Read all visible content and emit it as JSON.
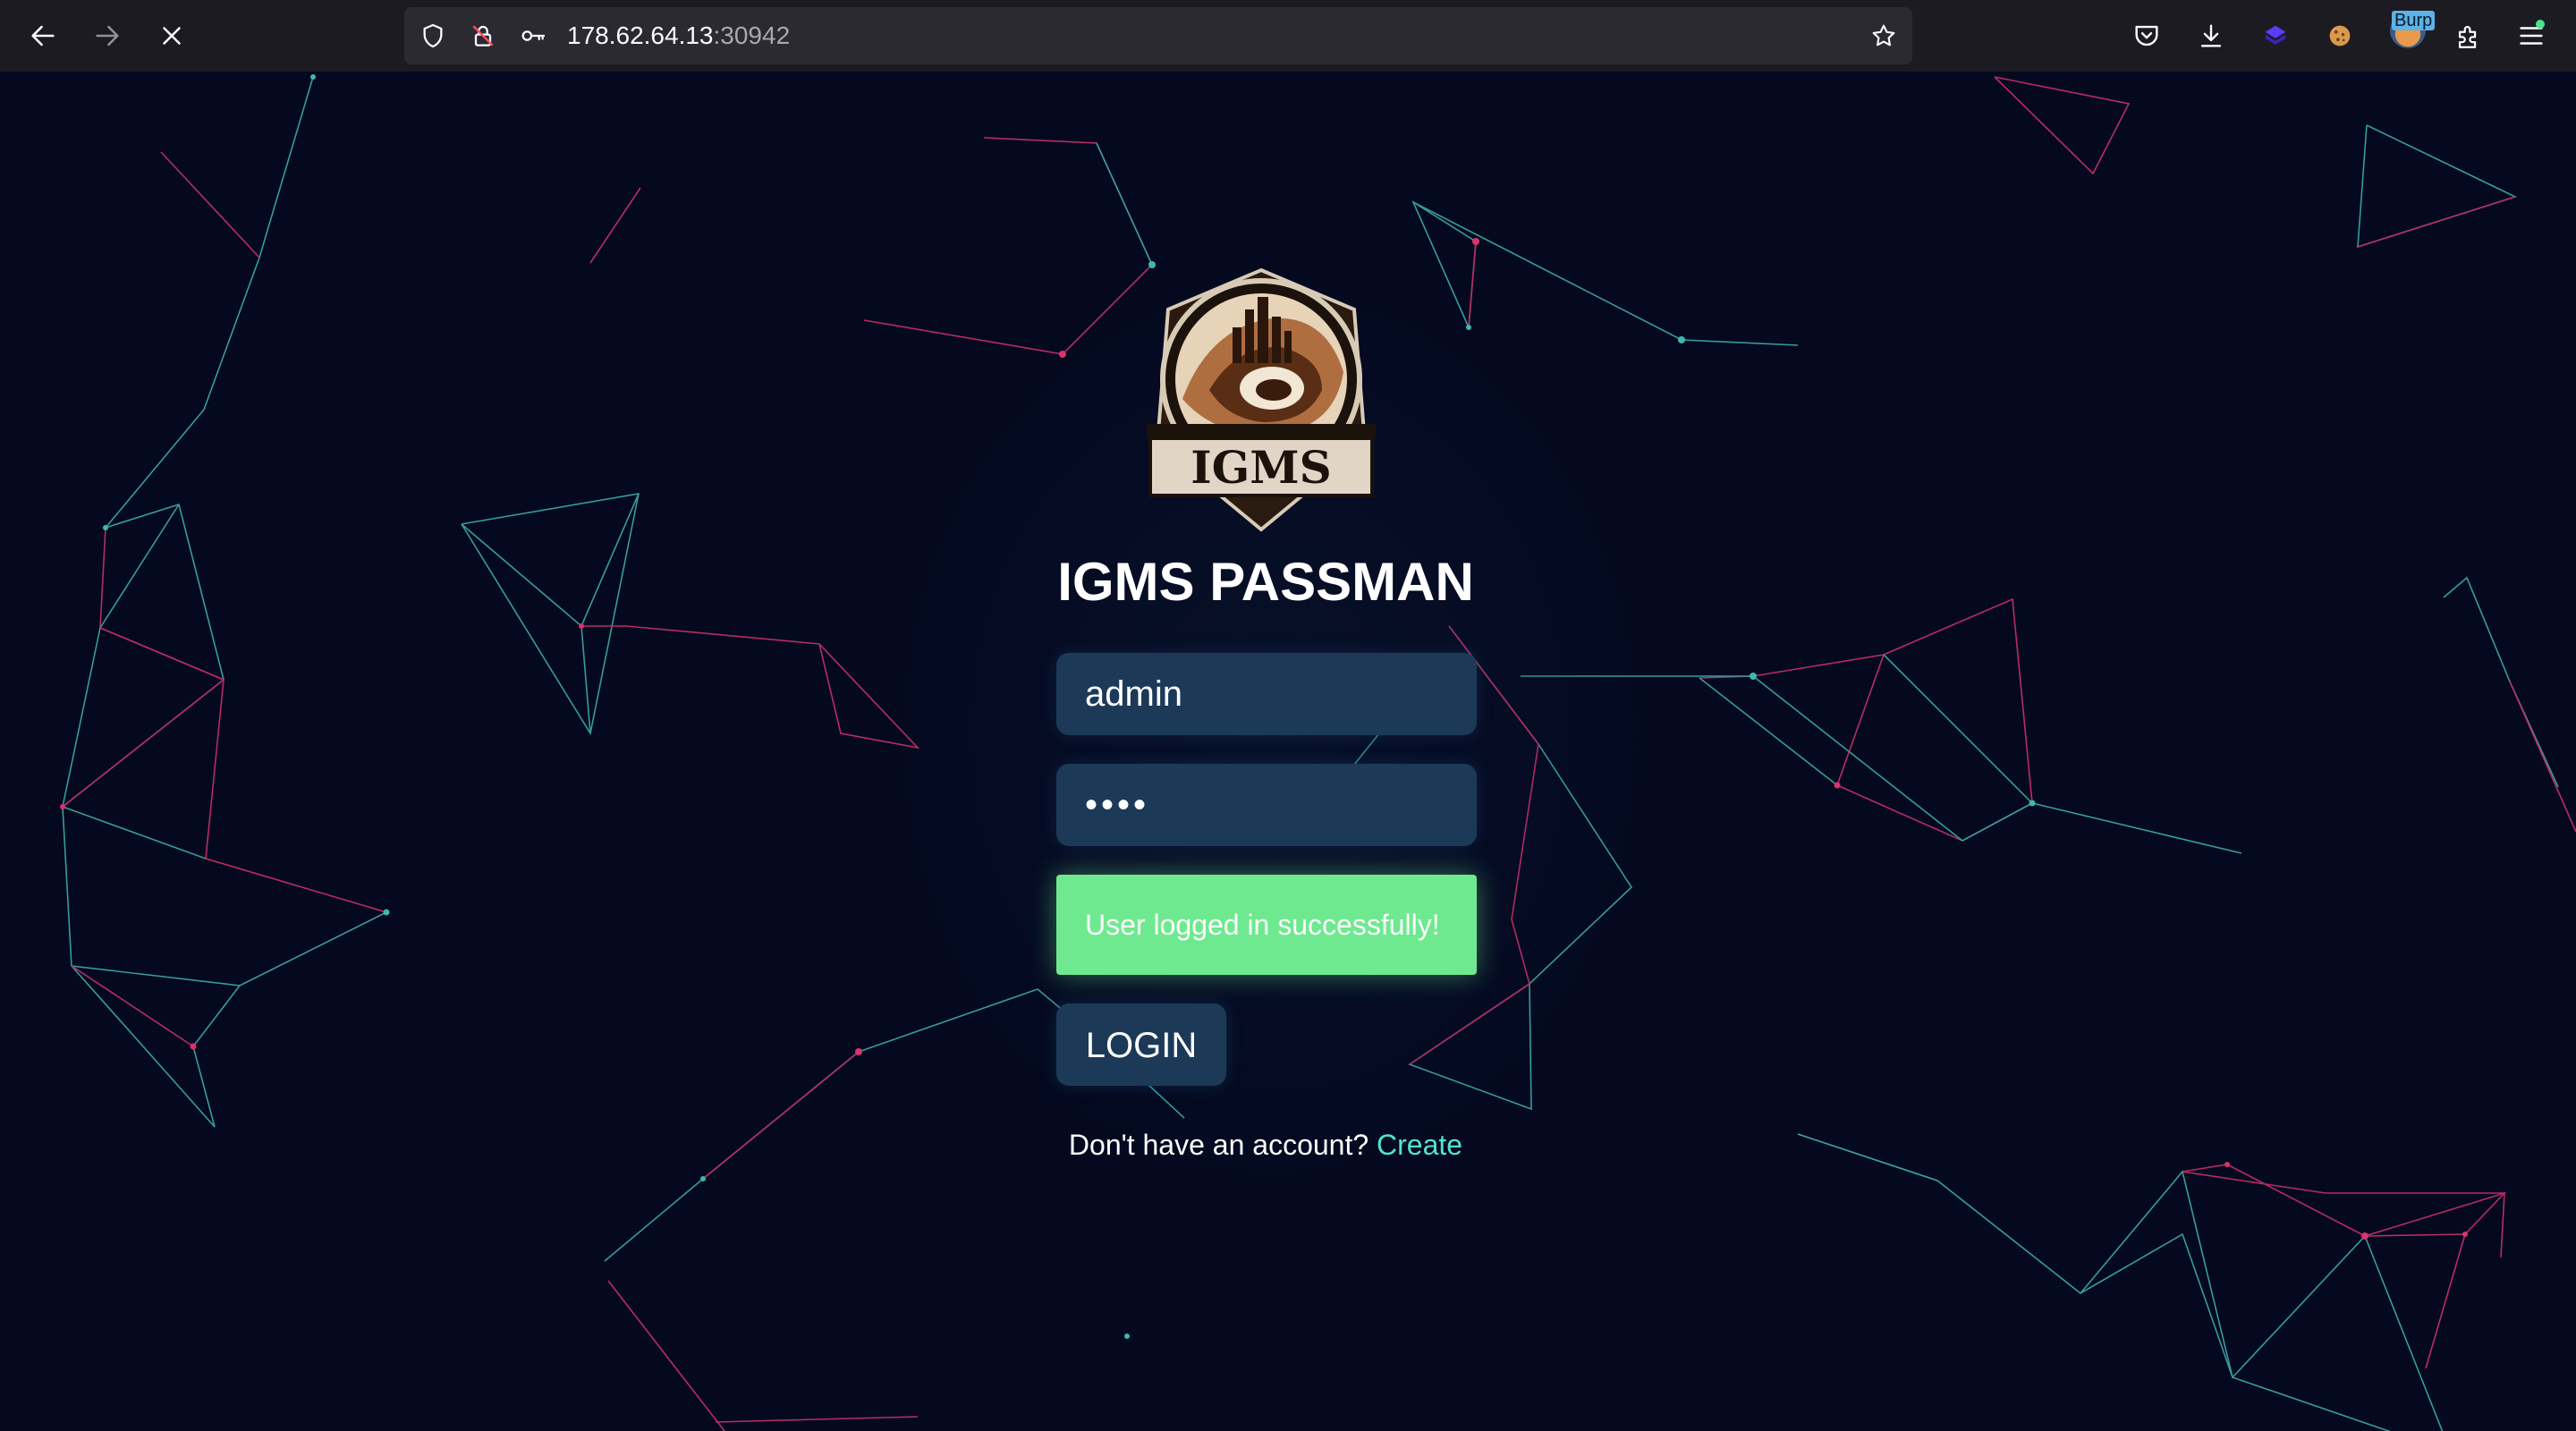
{
  "browser": {
    "url_host": "178.62.64.13",
    "url_port": ":30942",
    "extension_badge": "Burp"
  },
  "icons": {
    "back": "back-arrow-icon",
    "forward": "forward-arrow-icon",
    "stop": "stop-loading-icon",
    "tracking": "shield-icon",
    "insecure": "insecure-lock-icon",
    "permissions": "key-icon",
    "bookmark": "star-icon",
    "pocket": "pocket-icon",
    "downloads": "download-icon",
    "extension_1": "cube-extension-icon",
    "extension_2": "cookie-icon",
    "extension_3": "burp-icon",
    "extensions": "puzzle-icon",
    "menu": "hamburger-menu-icon"
  },
  "login": {
    "logo_text": "IGMS",
    "title": "IGMS PASSMAN",
    "username_value": "admin",
    "password_value": "••••",
    "success_message": "User logged in successfully!",
    "login_button": "LOGIN",
    "signup_prompt": "Don't have an account?",
    "signup_link": "Create"
  },
  "colors": {
    "background": "#040920",
    "field": "#1c3a58",
    "success": "#6ee98f",
    "link": "#52e3cf",
    "line_teal": "#3fb6b0",
    "line_pink": "#d9326f"
  }
}
